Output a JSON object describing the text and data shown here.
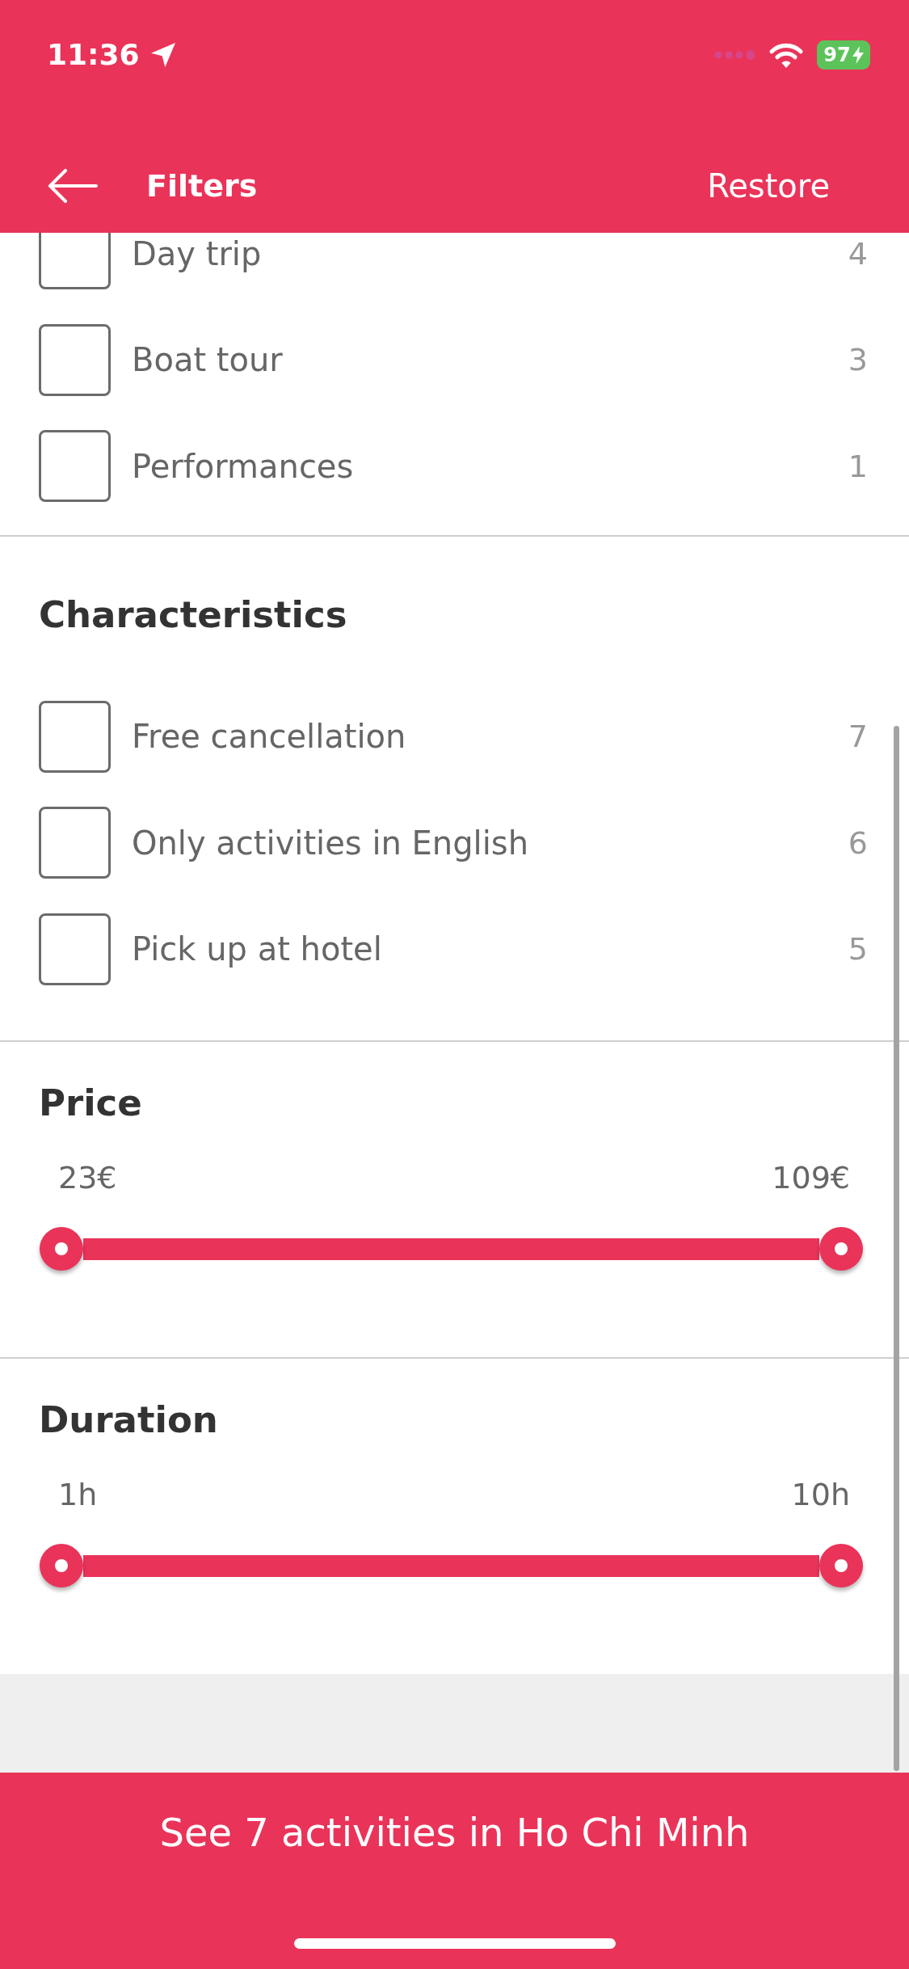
{
  "status_bar": {
    "time": "11:36",
    "battery": "97"
  },
  "nav": {
    "title": "Filters",
    "action": "Restore"
  },
  "sections": [
    {
      "kind": "checklist",
      "options": [
        {
          "label": "Day trip",
          "count": "4",
          "checked": false
        },
        {
          "label": "Boat tour",
          "count": "3",
          "checked": false
        },
        {
          "label": "Performances",
          "count": "1",
          "checked": false
        }
      ]
    },
    {
      "kind": "checklist",
      "title": "Characteristics",
      "options": [
        {
          "label": "Free cancellation",
          "count": "7",
          "checked": false
        },
        {
          "label": "Only activities in English",
          "count": "6",
          "checked": false
        },
        {
          "label": "Pick up at hotel",
          "count": "5",
          "checked": false
        }
      ]
    },
    {
      "kind": "range",
      "title": "Price",
      "min_label": "23€",
      "max_label": "109€",
      "level": 1
    },
    {
      "kind": "range",
      "title": "Duration",
      "min_label": "1h",
      "max_label": "10h",
      "level": 1
    }
  ],
  "footer_button": "See 7 activities in Ho Chi Minh"
}
